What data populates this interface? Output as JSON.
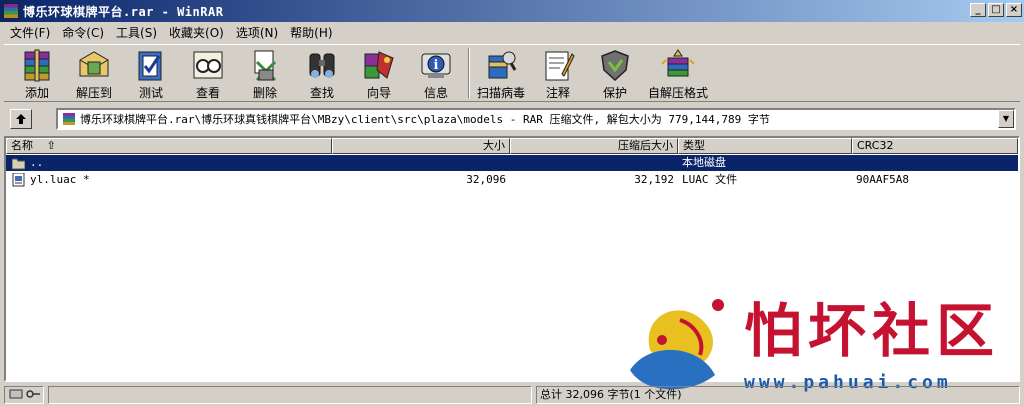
{
  "window": {
    "title": "博乐环球棋牌平台.rar - WinRAR",
    "controls": [
      "_",
      "□",
      "×"
    ]
  },
  "menu": [
    "文件(F)",
    "命令(C)",
    "工具(S)",
    "收藏夹(O)",
    "选项(N)",
    "帮助(H)"
  ],
  "toolbar": [
    {
      "label": "添加",
      "icon": "add-archive-icon"
    },
    {
      "label": "解压到",
      "icon": "extract-to-icon"
    },
    {
      "label": "测试",
      "icon": "test-icon"
    },
    {
      "label": "查看",
      "icon": "view-icon"
    },
    {
      "label": "删除",
      "icon": "delete-icon"
    },
    {
      "label": "查找",
      "icon": "find-icon"
    },
    {
      "label": "向导",
      "icon": "wizard-icon"
    },
    {
      "label": "信息",
      "icon": "info-icon"
    },
    {
      "label": "扫描病毒",
      "icon": "scan-virus-icon"
    },
    {
      "label": "注释",
      "icon": "comment-icon"
    },
    {
      "label": "保护",
      "icon": "protect-icon"
    },
    {
      "label": "自解压格式",
      "icon": "sfx-icon"
    }
  ],
  "address": {
    "path": "博乐环球棋牌平台.rar\\博乐环球真钱棋牌平台\\MBzy\\client\\src\\plaza\\models - RAR 压缩文件, 解包大小为 779,144,789 字节"
  },
  "columns": {
    "name": "名称",
    "size": "大小",
    "packed": "压缩后大小",
    "type": "类型",
    "crc": "CRC32"
  },
  "rows": [
    {
      "name": "..",
      "size": "",
      "packed": "",
      "type": "本地磁盘",
      "crc": "",
      "selected": true,
      "icon": "folder-icon"
    },
    {
      "name": "yl.luac *",
      "size": "32,096",
      "packed": "32,192",
      "type": "LUAC 文件",
      "crc": "90AAF5A8",
      "selected": false,
      "icon": "file-icon"
    }
  ],
  "status": {
    "summary": "总计 32,096 字节(1 个文件)"
  },
  "watermark": {
    "text": "怕坏社区",
    "url": "www.pahuai.com"
  },
  "colors": {
    "titlebar_start": "#0a246a",
    "titlebar_end": "#a6caf0",
    "selection": "#0a246a",
    "watermark_red": "#c41230",
    "watermark_blue": "#1a5aa8"
  }
}
